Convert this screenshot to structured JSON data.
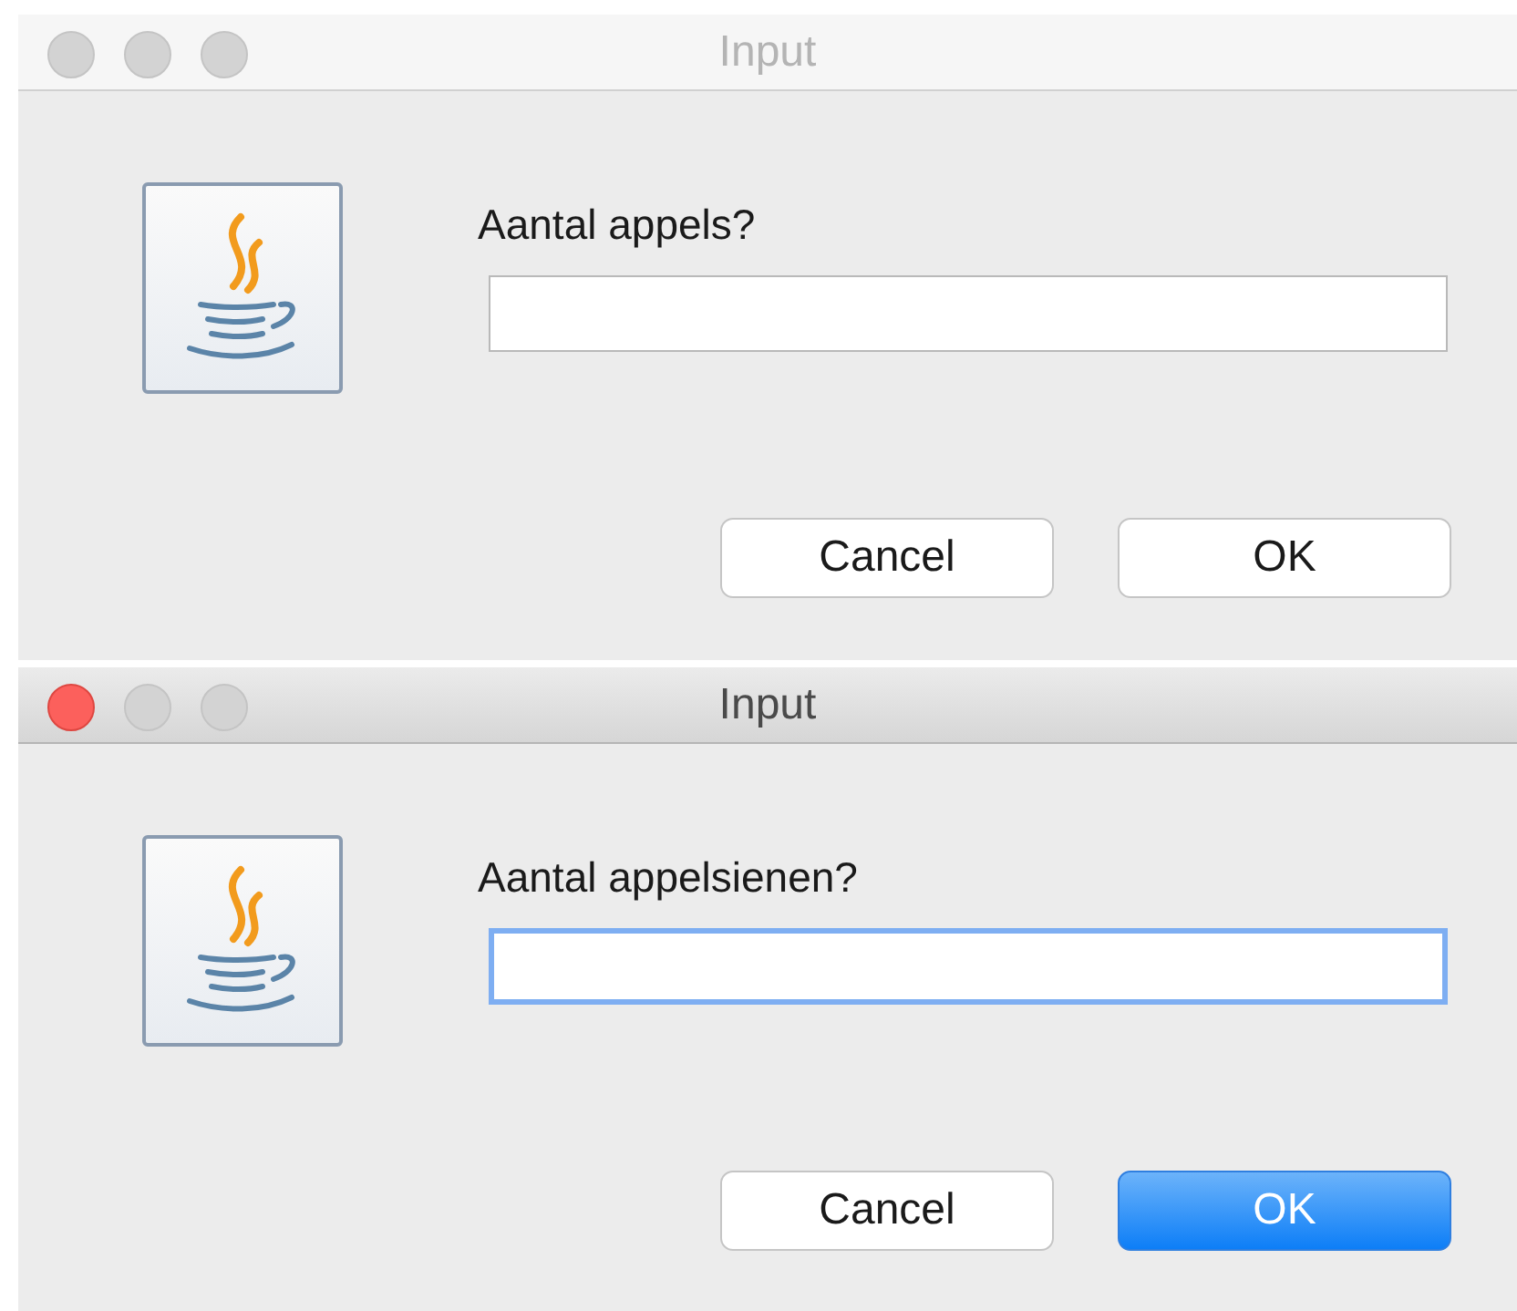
{
  "dialogs": [
    {
      "title": "Input",
      "active": false,
      "prompt": "Aantal appels?",
      "field": {
        "focused": false
      },
      "buttons": [
        {
          "label": "Cancel",
          "default": false
        },
        {
          "label": "OK",
          "default": false
        }
      ]
    },
    {
      "title": "Input",
      "active": true,
      "prompt": "Aantal appelsienen?",
      "field": {
        "focused": true
      },
      "buttons": [
        {
          "label": "Cancel",
          "default": false
        },
        {
          "label": "OK",
          "default": true
        }
      ]
    }
  ]
}
